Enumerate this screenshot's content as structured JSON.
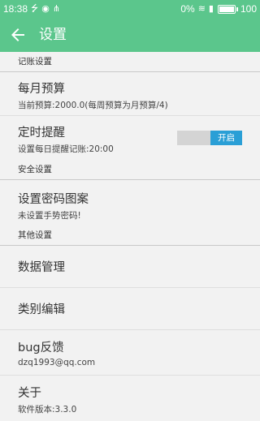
{
  "status_bar": {
    "time": "18:38",
    "left_icons": [
      "usb-icon",
      "sync-icon",
      "share-icon"
    ],
    "battery_percent_text": "0%",
    "battery_level": "100",
    "right_icons": [
      "wifi-icon",
      "signal-icon",
      "battery-icon"
    ]
  },
  "toolbar": {
    "title": "设置",
    "back_icon": "arrow-left-icon",
    "color": "#5bc68c"
  },
  "sections": {
    "accounting": {
      "header": "记账设置",
      "monthly_budget": {
        "title": "每月预算",
        "subtitle": "当前预算:2000.0(每周预算为月预算/4)"
      },
      "reminder": {
        "title": "定时提醒",
        "subtitle": "设置每日提醒记账:20:00",
        "toggle_label": "开启",
        "toggle_color": "#2a9fd6"
      }
    },
    "security": {
      "header": "安全设置",
      "pattern": {
        "title": "设置密码图案",
        "subtitle": "未设置手势密码!"
      }
    },
    "other": {
      "header": "其他设置",
      "data_manage": {
        "title": "数据管理"
      },
      "category_edit": {
        "title": "类别编辑"
      },
      "bug": {
        "title": "bug反馈",
        "subtitle": "dzq1993@qq.com"
      },
      "about": {
        "title": "关于",
        "subtitle": "软件版本:3.3.0"
      }
    }
  }
}
